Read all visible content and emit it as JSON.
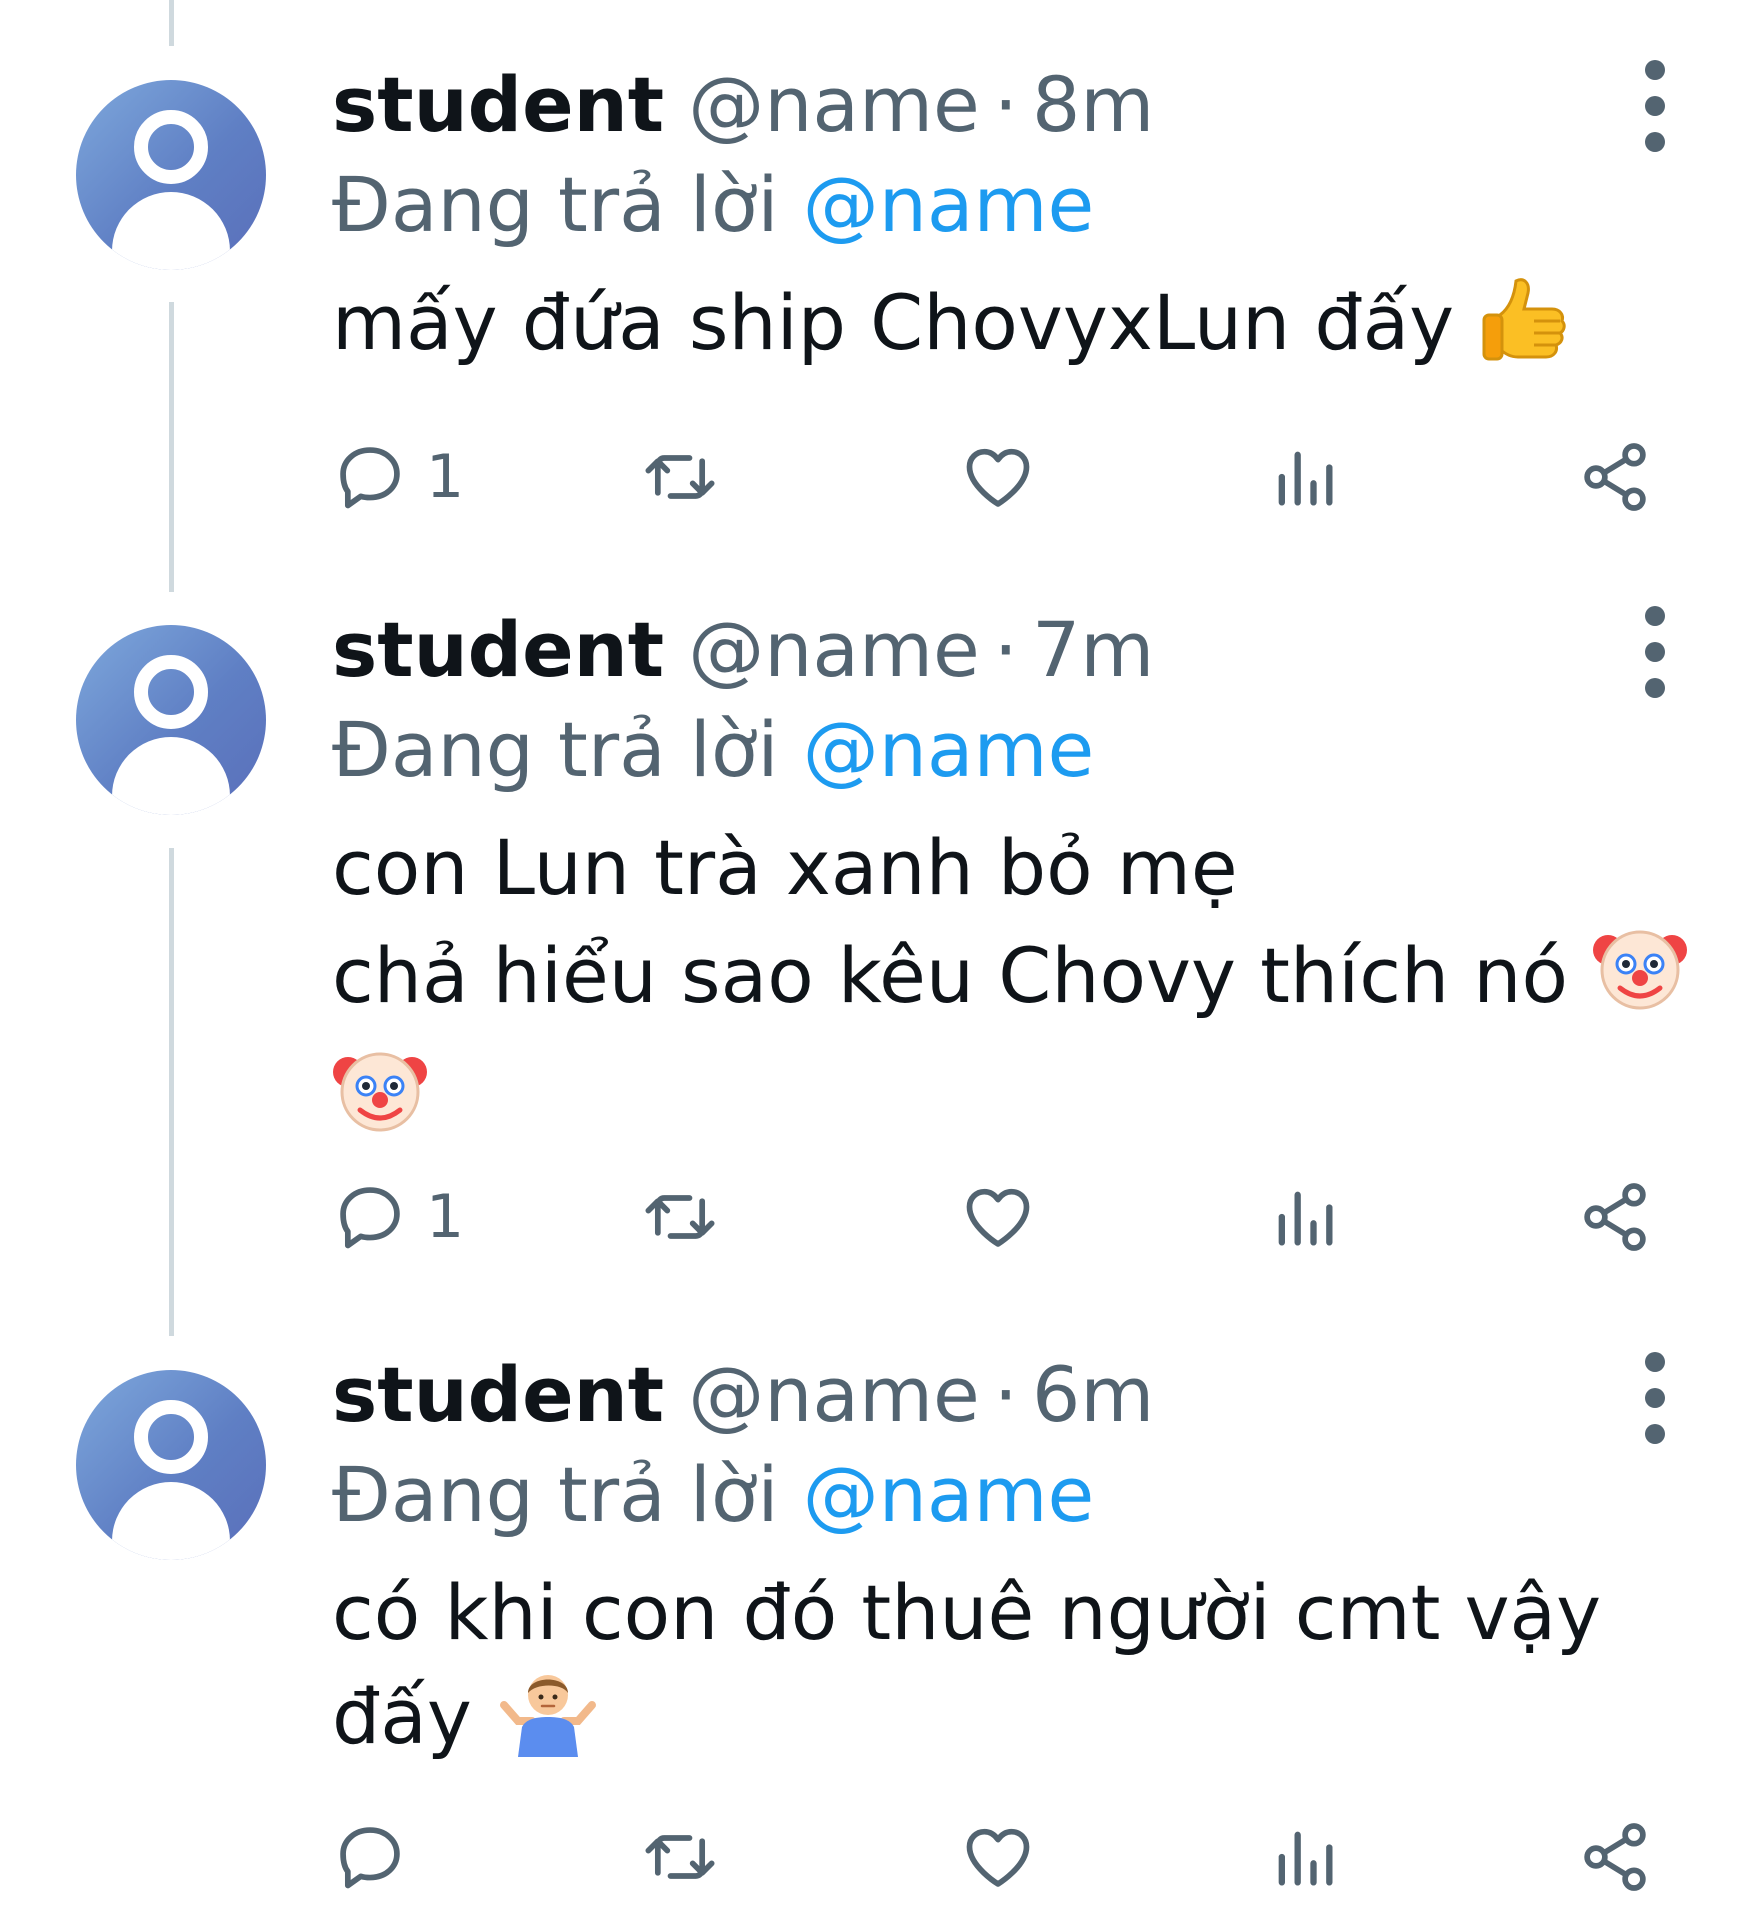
{
  "tweets": [
    {
      "name": "student",
      "handle": "@name",
      "separator": "·",
      "time": "8m",
      "reply_prefix": "Đang trả lời",
      "reply_to": "@name",
      "text_lines": [
        "mấy đứa ship ChovyxLun đấy"
      ],
      "emoji": [
        "thumbs-up-emoji"
      ],
      "reply_count": "1"
    },
    {
      "name": "student",
      "handle": "@name",
      "separator": "·",
      "time": "7m",
      "reply_prefix": "Đang trả lời",
      "reply_to": "@name",
      "text_lines": [
        "con Lun trà xanh bỏ mẹ",
        "chả hiểu sao kêu Chovy thích nó"
      ],
      "emoji": [
        "clown-face-emoji",
        "clown-face-emoji"
      ],
      "reply_count": "1"
    },
    {
      "name": "student",
      "handle": "@name",
      "separator": "·",
      "time": "6m",
      "reply_prefix": "Đang trả lời",
      "reply_to": "@name",
      "text_lines": [
        "có khi con đó thuê người cmt vậy",
        "đấy"
      ],
      "emoji": [
        "person-shrugging-emoji"
      ],
      "reply_count": ""
    }
  ],
  "icons": {
    "reply": "reply-icon",
    "retweet": "retweet-icon",
    "like": "heart-icon",
    "views": "views-icon",
    "share": "share-icon",
    "more": "more-vertical-icon"
  },
  "colors": {
    "text": "#0f1419",
    "secondary": "#536471",
    "mention": "#1d9bf0",
    "thread_line": "#cfd9de"
  }
}
